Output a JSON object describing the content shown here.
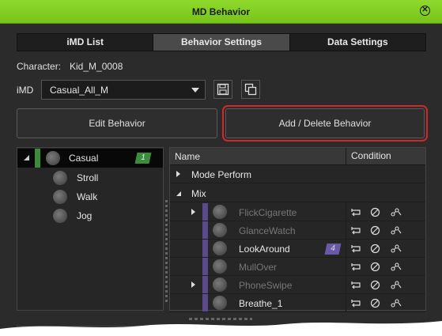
{
  "window": {
    "title": "MD Behavior"
  },
  "tabs": [
    {
      "label": "iMD List",
      "active": false
    },
    {
      "label": "Behavior Settings",
      "active": true
    },
    {
      "label": "Data Settings",
      "active": false
    }
  ],
  "character": {
    "label": "Character:",
    "value": "Kid_M_0008"
  },
  "imd": {
    "label": "iMD",
    "selected": "Casual_All_M"
  },
  "buttons": {
    "edit": "Edit Behavior",
    "add_delete": "Add / Delete Behavior"
  },
  "left_list": {
    "group": {
      "label": "Casual",
      "count": "1"
    },
    "items": [
      {
        "label": "Stroll"
      },
      {
        "label": "Walk"
      },
      {
        "label": "Jog"
      }
    ]
  },
  "table": {
    "columns": {
      "name": "Name",
      "condition": "Condition"
    },
    "groups": [
      {
        "label": "Mode Perform"
      },
      {
        "label": "Mix"
      }
    ],
    "rows": [
      {
        "label": "FlickCigarette",
        "enabled": false
      },
      {
        "label": "GlanceWatch",
        "enabled": false
      },
      {
        "label": "LookAround",
        "enabled": true,
        "badge": "4"
      },
      {
        "label": "MullOver",
        "enabled": false
      },
      {
        "label": "PhoneSwipe",
        "enabled": false
      },
      {
        "label": "Breathe_1",
        "enabled": true
      }
    ]
  },
  "colors": {
    "title_bar": "#7fcc22",
    "highlight": "#d42828",
    "group_bar": "#3c8a3c",
    "row_bar": "#5a4a8c"
  }
}
